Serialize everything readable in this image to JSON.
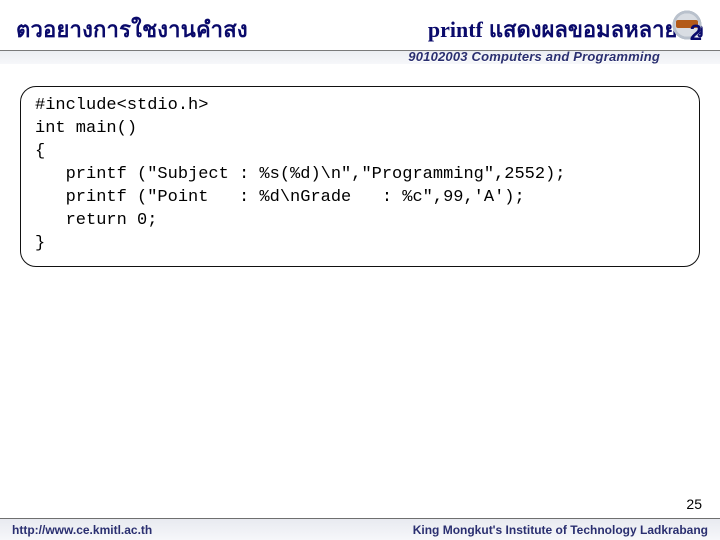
{
  "header": {
    "title_left": "ตวอยางการใชงานคำสง",
    "title_printf": "printf",
    "title_right_text": "แสดงผลขอมลหลายตว",
    "title_number": "2",
    "course_line": "90102003 Computers and Programming"
  },
  "code": {
    "text": "#include<stdio.h>\nint main()\n{\n   printf (\"Subject : %s(%d)\\n\",\"Programming\",2552);\n   printf (\"Point   : %d\\nGrade   : %c\",99,'A');\n   return 0;\n}"
  },
  "slide_number": "25",
  "footer": {
    "left": "http://www.ce.kmitl.ac.th",
    "right": "King Mongkut's Institute of Technology Ladkrabang"
  }
}
